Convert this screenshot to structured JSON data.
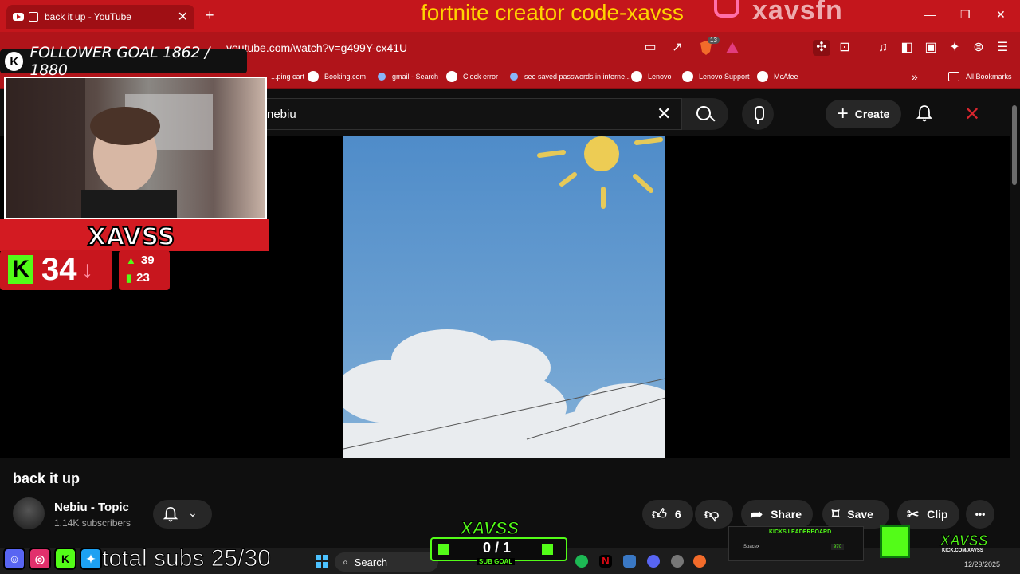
{
  "browser": {
    "tab_title": "back it up - YouTube",
    "tab_close": "✕",
    "new_tab": "+",
    "url": "youtube.com/watch?v=g499Y-cx41U",
    "bookmarks": [
      {
        "label": "...ping cart"
      },
      {
        "label": "Booking.com"
      },
      {
        "label": "gmail - Search"
      },
      {
        "label": "Clock error"
      },
      {
        "label": "see saved passwords in interne..."
      },
      {
        "label": "Lenovo"
      },
      {
        "label": "Lenovo Support"
      },
      {
        "label": "McAfee"
      }
    ],
    "more_bookmarks": "»",
    "all_bookmarks": "All Bookmarks",
    "brave_shield_count": "13"
  },
  "overlay": {
    "title": "fortnite creator code-xavss",
    "instagram_handle": "xavsfn",
    "follower_goal": "FOLLOWER GOAL 1862 / 1880",
    "cam_name": "XAVSS",
    "kick_k": "K",
    "kick_viewers": "34",
    "stat_up": "39",
    "stat_bars": "23",
    "total_subs": "total subs 25/30",
    "sub_goal_brand": "XAVSS",
    "sub_goal_value": "0 / 1",
    "sub_goal_label": "SUB GOAL",
    "leaderboard_title": "KICKS LEADERBOARD",
    "leaderboard_user": "Spacex",
    "leaderboard_amount": "970",
    "brand_name": "XAVSS",
    "brand_url": "KICK.COM/XAVSS"
  },
  "youtube": {
    "search_value": "nebiu",
    "search_clear": "✕",
    "create_label": "Create",
    "create_plus": "+",
    "video_title": "back it up",
    "channel_name": "Nebiu - Topic",
    "subscribers": "1.14K subscribers",
    "like_count": "6",
    "share_label": "Share",
    "save_label": "Save",
    "clip_label": "Clip",
    "more_label": "•••"
  },
  "taskbar": {
    "search_label": "Search",
    "date": "12/29/2025"
  },
  "colors": {
    "browser_red": "#c4161c",
    "kick_green": "#53fc18",
    "overlay_yellow": "#ffd400"
  }
}
